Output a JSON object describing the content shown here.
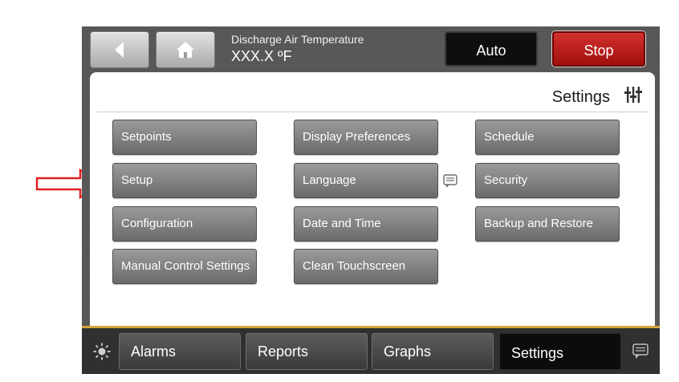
{
  "header": {
    "back_icon": "back-arrow-icon",
    "home_icon": "home-icon",
    "temperature_title": "Discharge Air Temperature",
    "temperature_value": "XXX.X ºF",
    "auto_label": "Auto",
    "stop_label": "Stop"
  },
  "panel": {
    "title": "Settings",
    "title_icon": "settings-sliders-icon",
    "buttons": {
      "setpoints": "Setpoints",
      "setup": "Setup",
      "configuration": "Configuration",
      "manual_control": "Manual Control Settings",
      "display_preferences": "Display Preferences",
      "language": "Language",
      "date_time": "Date and Time",
      "clean_touchscreen": "Clean Touchscreen",
      "schedule": "Schedule",
      "security": "Security",
      "backup_restore": "Backup and Restore"
    }
  },
  "bottom_tabs": {
    "alarms": "Alarms",
    "reports": "Reports",
    "graphs": "Graphs",
    "settings": "Settings",
    "active": "Settings"
  },
  "colors": {
    "stop_red": "#c0201d",
    "arrow_red": "#e02020",
    "accent_gold": "#d7a43b"
  }
}
